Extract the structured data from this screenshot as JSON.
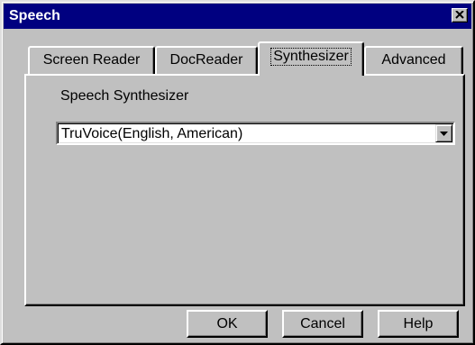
{
  "window": {
    "title": "Speech",
    "close_icon": "close-x-icon"
  },
  "tabs": [
    {
      "label": "Screen Reader",
      "active": false
    },
    {
      "label": "DocReader",
      "active": false
    },
    {
      "label": "Synthesizer",
      "active": true
    },
    {
      "label": "Advanced",
      "active": false
    }
  ],
  "synthesizer": {
    "group_label": "Speech Synthesizer",
    "selected_value": "TruVoice(English, American)",
    "dropdown_icon": "dropdown-arrow-icon"
  },
  "buttons": {
    "ok": "OK",
    "cancel": "Cancel",
    "help": "Help"
  },
  "colors": {
    "face": "#c0c0c0",
    "titlebar": "#000080",
    "title_text": "#ffffff"
  }
}
